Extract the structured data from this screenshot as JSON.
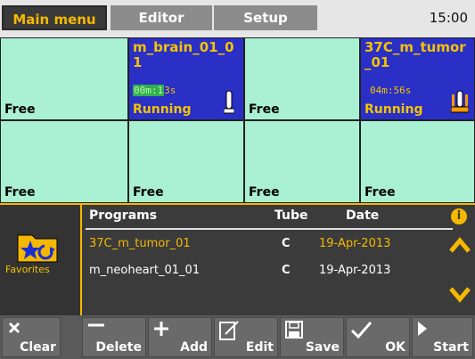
{
  "tabs": {
    "main_menu": "Main menu",
    "editor": "Editor",
    "setup": "Setup"
  },
  "clock": "15:00",
  "slots": [
    {
      "status": "Free"
    },
    {
      "name": "m_brain_01_01",
      "timer_hl": "00m:1",
      "timer_rest": "3s",
      "status": "Running"
    },
    {
      "status": "Free"
    },
    {
      "name": "37C_m_tumor_01",
      "timer": "04m:56s",
      "status": "Running"
    },
    {
      "status": "Free"
    },
    {
      "status": "Free"
    },
    {
      "status": "Free"
    },
    {
      "status": "Free"
    }
  ],
  "favorites": {
    "label": "Favorites"
  },
  "programs": {
    "headers": {
      "programs": "Programs",
      "tube": "Tube",
      "date": "Date"
    },
    "rows": [
      {
        "name": "37C_m_tumor_01",
        "tube": "C",
        "date": "19-Apr-2013",
        "selected": true
      },
      {
        "name": "m_neoheart_01_01",
        "tube": "C",
        "date": "19-Apr-2013",
        "selected": false
      }
    ]
  },
  "toolbar": {
    "clear": "Clear",
    "delete": "Delete",
    "add": "Add",
    "edit": "Edit",
    "save": "Save",
    "ok": "OK",
    "start": "Start"
  },
  "colors": {
    "accent": "#f5b800",
    "free_slot": "#aaf0d2",
    "running_slot": "#2a2fc6"
  }
}
